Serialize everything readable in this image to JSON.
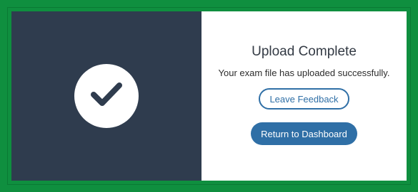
{
  "dialog": {
    "title": "Upload Complete",
    "message": "Your exam file has uploaded successfully.",
    "icon": "checkmark-icon"
  },
  "actions": {
    "feedback_label": "Leave Feedback",
    "dashboard_label": "Return to Dashboard"
  },
  "colors": {
    "border": "#0f8f3f",
    "panel": "#2f3c4e",
    "accent": "#2f6fa6"
  }
}
